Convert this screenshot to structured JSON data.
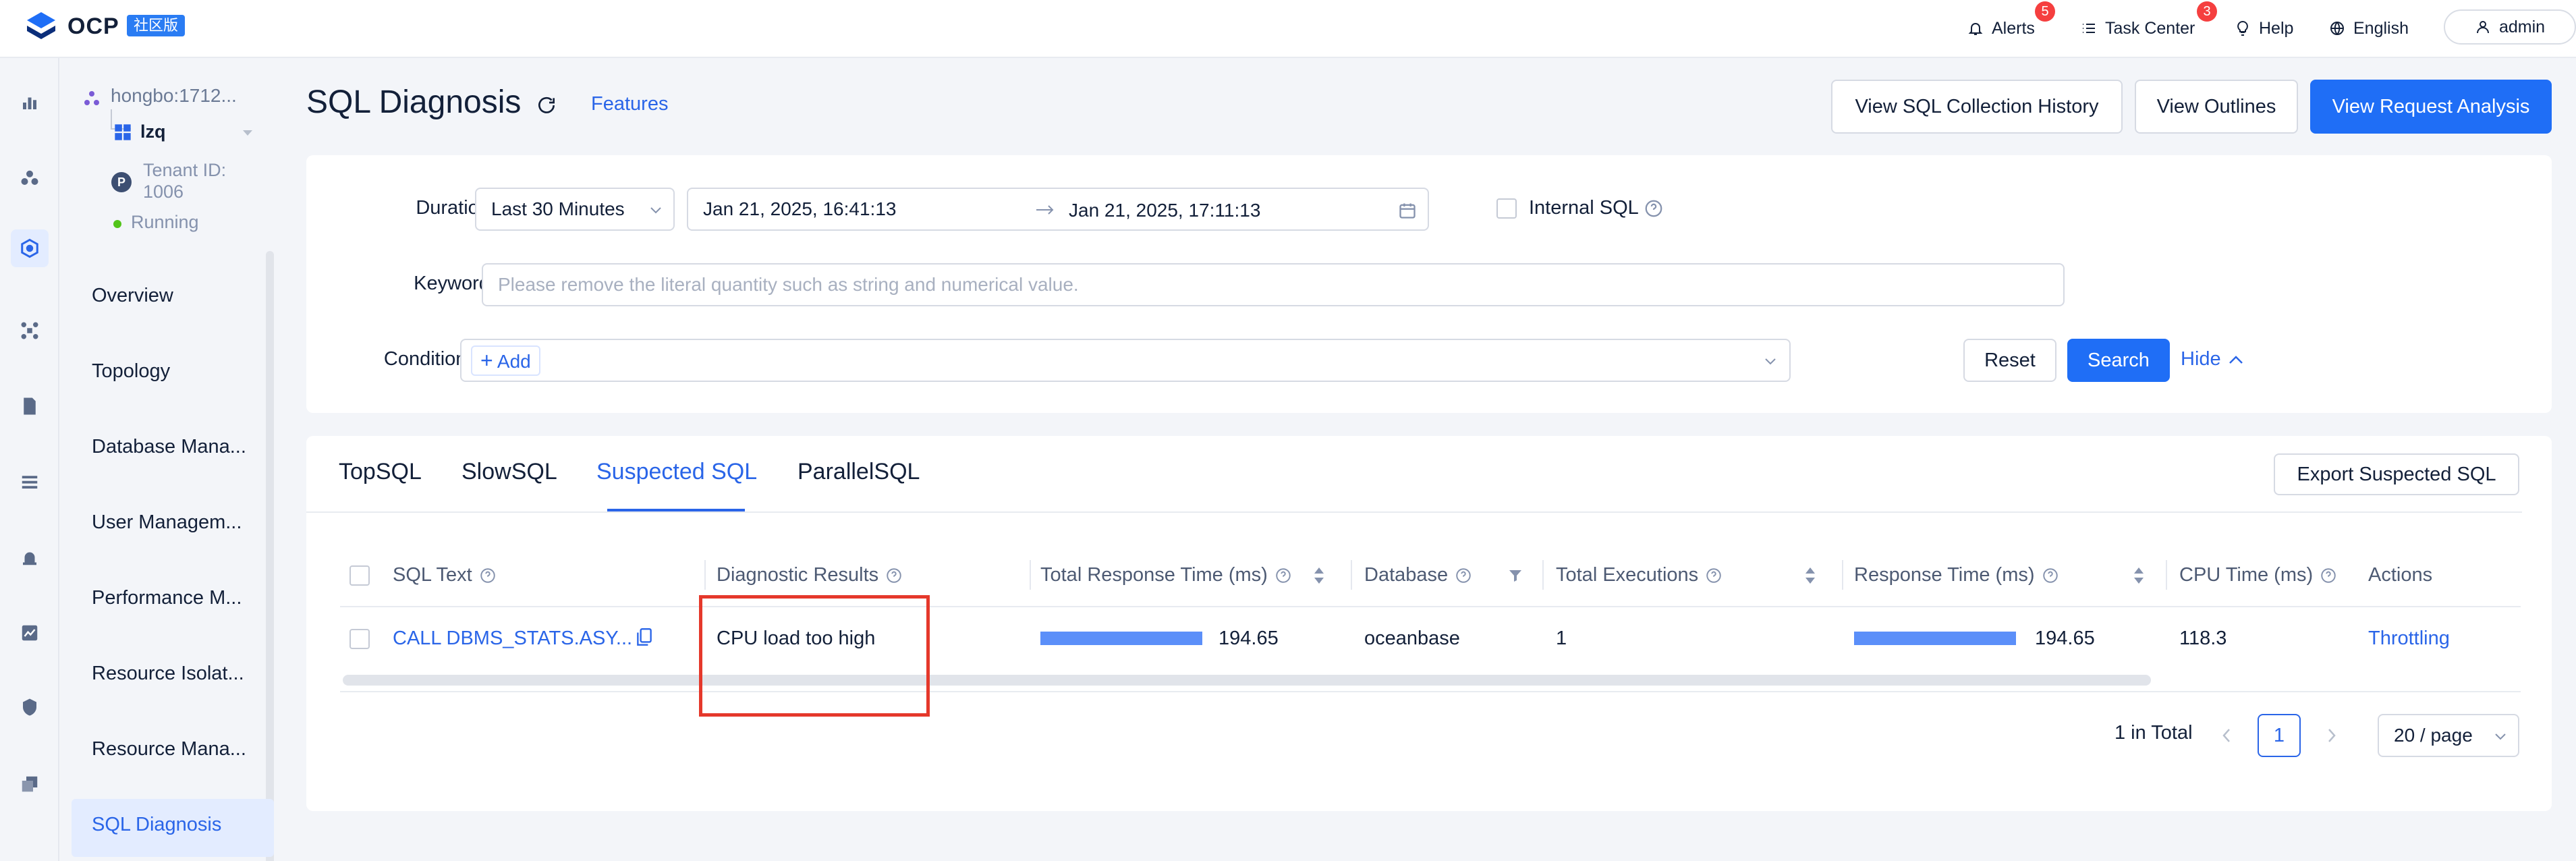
{
  "topbar": {
    "logo_text": "OCP",
    "logo_badge": "社区版",
    "alerts_label": "Alerts",
    "alerts_count": "5",
    "task_center_label": "Task Center",
    "task_center_count": "3",
    "help_label": "Help",
    "language_label": "English",
    "user_label": "admin"
  },
  "nav": {
    "cluster_name": "hongbo:1712...",
    "tenant_name": "lzq",
    "tenant_id": "Tenant ID: 1006",
    "tenant_status": "Running",
    "items": [
      {
        "label": "Overview"
      },
      {
        "label": "Topology"
      },
      {
        "label": "Database Mana..."
      },
      {
        "label": "User Managem..."
      },
      {
        "label": "Performance M..."
      },
      {
        "label": "Resource Isolat..."
      },
      {
        "label": "Resource Mana..."
      },
      {
        "label": "SQL Diagnosis"
      }
    ]
  },
  "header": {
    "title": "SQL Diagnosis",
    "features_link": "Features",
    "btn_history": "View SQL Collection History",
    "btn_outlines": "View Outlines",
    "btn_request": "View Request Analysis"
  },
  "filters": {
    "duration_label": "Duration",
    "duration_value": "Last 30 Minutes",
    "start_time": "Jan 21, 2025, 16:41:13",
    "end_time": "Jan 21, 2025, 17:11:13",
    "internal_sql_label": "Internal SQL",
    "keyword_label": "Keyword",
    "keyword_placeholder": "Please remove the literal quantity such as string and numerical value.",
    "conditions_label": "Conditions",
    "add_label": "Add",
    "reset_label": "Reset",
    "search_label": "Search",
    "hide_label": "Hide"
  },
  "tabs": [
    {
      "label": "TopSQL"
    },
    {
      "label": "SlowSQL"
    },
    {
      "label": "Suspected SQL"
    },
    {
      "label": "ParallelSQL"
    }
  ],
  "export_label": "Export Suspected SQL",
  "table": {
    "columns": [
      "SQL Text",
      "Diagnostic Results",
      "Total Response Time (ms)",
      "Database",
      "Total Executions",
      "Response Time (ms)",
      "CPU Time (ms)",
      "Actions"
    ],
    "rows": [
      {
        "sql_text": "CALL DBMS_STATS.ASY...",
        "diagnostic": "CPU load too high",
        "total_response_time": "194.65",
        "total_response_fraction": 1.0,
        "database": "oceanbase",
        "total_executions": "1",
        "response_time": "194.65",
        "response_fraction": 1.0,
        "cpu_time": "118.3",
        "action": "Throttling"
      }
    ]
  },
  "pagination": {
    "total": "1 in Total",
    "current_page": "1",
    "page_size": "20 / page"
  },
  "colors": {
    "accent": "#1f6ef6",
    "link": "#2a65e8",
    "highlight_box": "#e5382b",
    "bar": "#5b8ff9"
  }
}
